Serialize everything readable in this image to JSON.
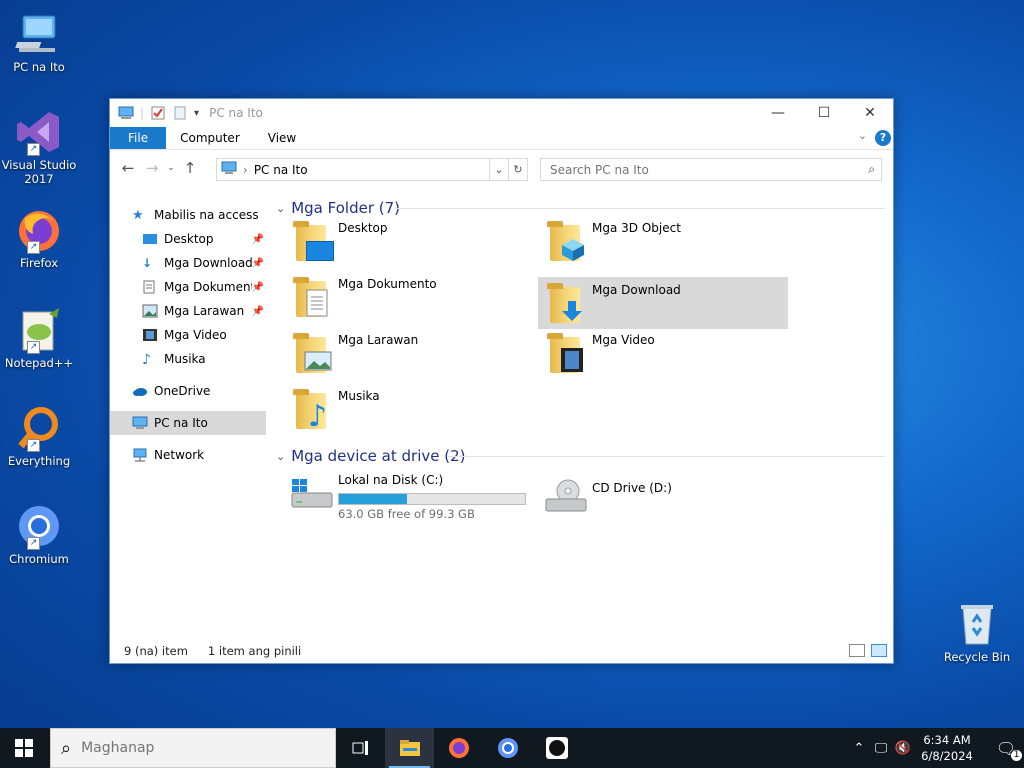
{
  "desktop": {
    "icons": [
      {
        "label": "PC na Ito",
        "icon": "computer-icon"
      },
      {
        "label": "Visual Studio 2017",
        "icon": "visual-studio-icon"
      },
      {
        "label": "Firefox",
        "icon": "firefox-icon"
      },
      {
        "label": "Notepad++",
        "icon": "notepadpp-icon"
      },
      {
        "label": "Everything",
        "icon": "everything-icon"
      },
      {
        "label": "Chromium",
        "icon": "chromium-icon"
      }
    ],
    "recycle_bin": "Recycle Bin"
  },
  "window": {
    "title": "PC na Ito",
    "ribbon_tabs": [
      "File",
      "Computer",
      "View"
    ],
    "address": {
      "path": "PC na Ito"
    },
    "search": {
      "placeholder": "Search PC na Ito"
    },
    "nav": {
      "quick_access": "Mabilis na access",
      "quick_items": [
        "Desktop",
        "Mga Download",
        "Mga Dokumento",
        "Mga Larawan",
        "Mga Video",
        "Musika"
      ],
      "onedrive": "OneDrive",
      "this_pc": "PC na Ito",
      "network": "Network"
    },
    "folders_group": "Mga Folder (7)",
    "folders": [
      "Desktop",
      "Mga 3D Object",
      "Mga Dokumento",
      "Mga Download",
      "Mga Larawan",
      "Mga Video",
      "Musika"
    ],
    "devices_group": "Mga device at drive (2)",
    "drives": [
      {
        "name": "Lokal na Disk (C:)",
        "free": "63.0 GB free of 99.3 GB",
        "used_fraction": 0.366
      },
      {
        "name": "CD Drive (D:)"
      }
    ],
    "status": {
      "items": "9 (na) item",
      "selected": "1 item ang pinili"
    }
  },
  "taskbar": {
    "search_placeholder": "Maghanap",
    "time": "6:34 AM",
    "date": "6/8/2024",
    "notification_count": "1"
  }
}
